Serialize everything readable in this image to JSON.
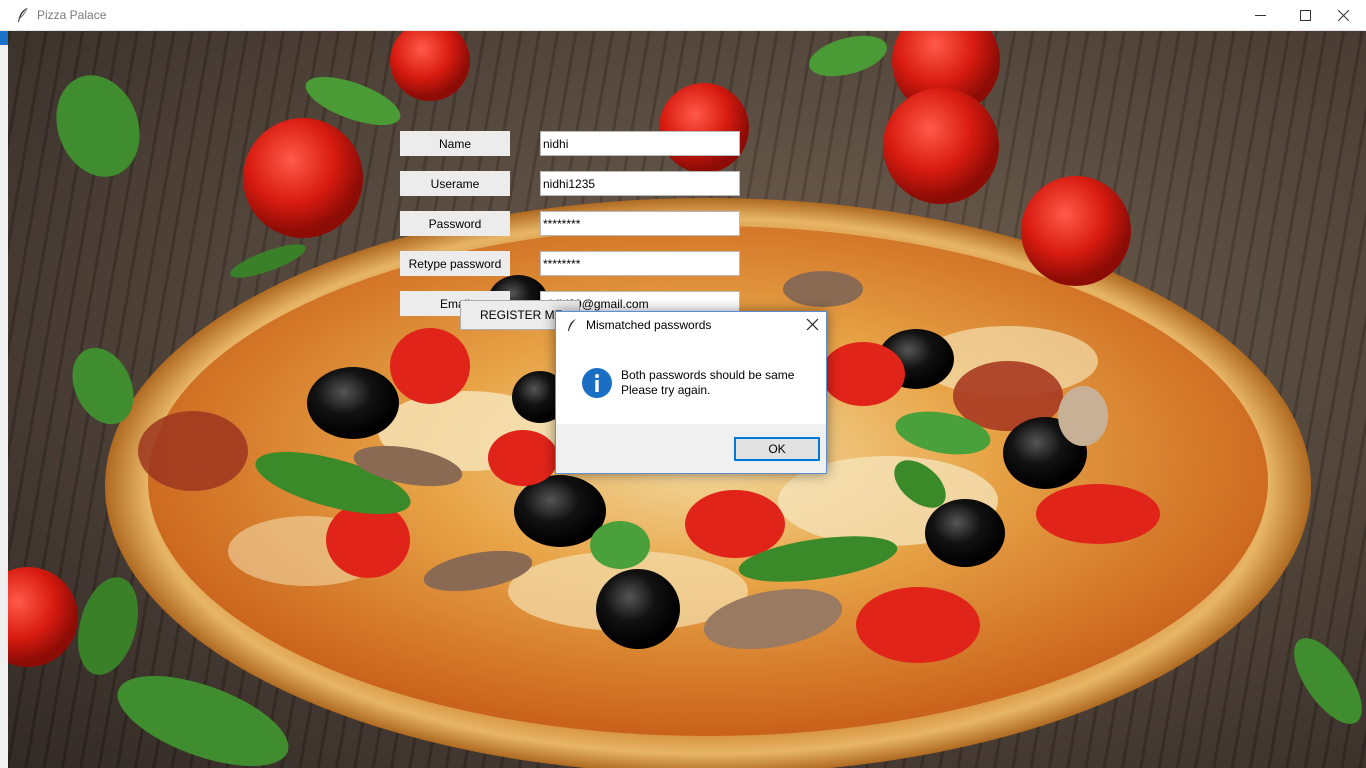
{
  "window": {
    "title": "Pizza Palace"
  },
  "form": {
    "name_label": "Name",
    "name_value": "nidhi",
    "username_label": "Userame",
    "username_value": "nidhi1235",
    "password_label": "Password",
    "password_value": "********",
    "retype_label": "Retype password",
    "retype_value": "********",
    "email_label": "Email",
    "email_value": "nidhi20@gmail.com",
    "register_label": "REGISTER ME"
  },
  "dialog": {
    "title": "Mismatched passwords",
    "message_line1": "Both passwords should be same",
    "message_line2": "Please try again.",
    "ok_label": "OK"
  },
  "colors": {
    "dialog_border": "#5c8ed1",
    "focus_accent": "#0078d7",
    "info_icon": "#1a6fc4"
  },
  "icons": [
    "feather-icon",
    "minimize-icon",
    "maximize-icon",
    "close-icon",
    "info-icon"
  ]
}
